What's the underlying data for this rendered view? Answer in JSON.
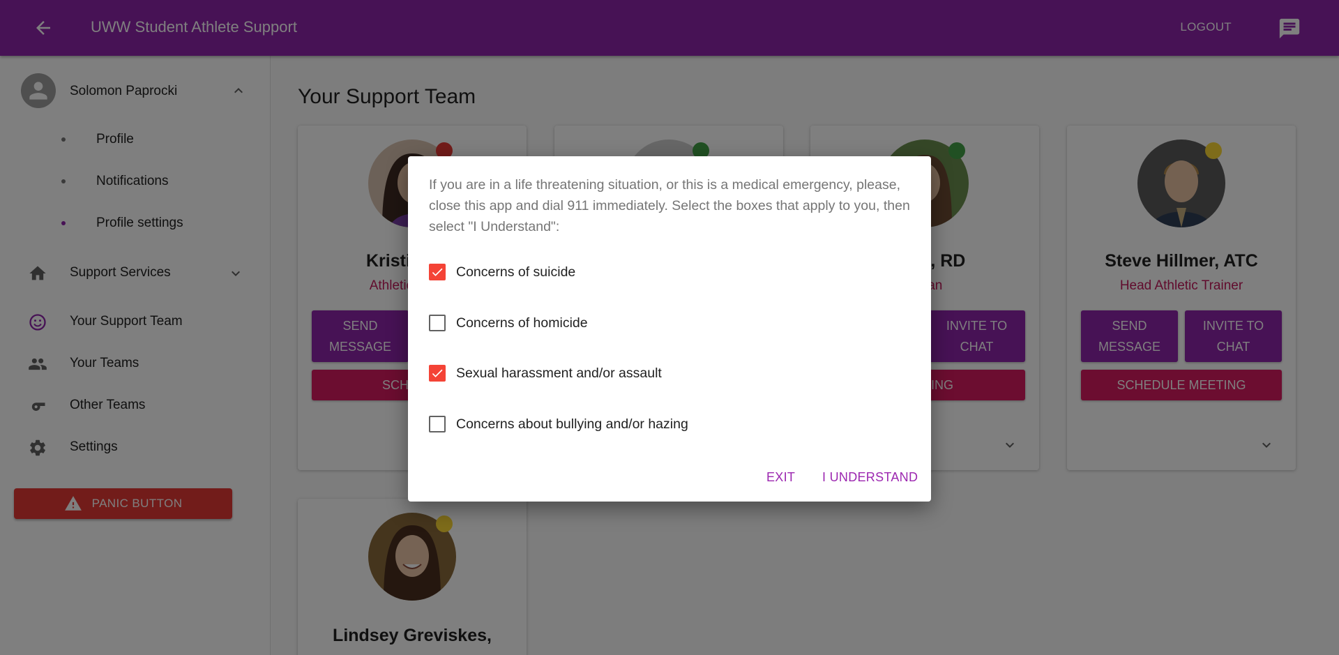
{
  "app": {
    "title": "UWW Student Athlete Support",
    "logout_label": "LOGOUT",
    "colors": {
      "primary": "#8e24aa",
      "secondary": "#d81b60",
      "danger": "#e53935",
      "accent_text": "#c2185b"
    }
  },
  "sidebar": {
    "user_name": "Solomon Paprocki",
    "sub_items": [
      {
        "label": "Profile"
      },
      {
        "label": "Notifications"
      },
      {
        "label": "Profile settings"
      }
    ],
    "items": [
      {
        "label": "Support Services",
        "icon": "home-icon"
      },
      {
        "label": "Your Support Team",
        "icon": "smiley-icon"
      },
      {
        "label": "Your Teams",
        "icon": "people-icon"
      },
      {
        "label": "Other Teams",
        "icon": "whistle-icon"
      },
      {
        "label": "Settings",
        "icon": "gear-icon"
      }
    ],
    "panic_label": "PANIC BUTTON"
  },
  "main": {
    "title": "Your Support Team",
    "cards": [
      {
        "name": "Kristina Na",
        "role": "Athletics Depa",
        "status_color": "#e53935",
        "send_label_1": "SEND",
        "send_label_2": "MESSAGE",
        "schedule_label": "SCHEDUL"
      },
      {
        "status_color": "#43a047"
      },
      {
        "name": "mdoll, RD",
        "role": "etitian",
        "status_color": "#43a047",
        "invite_label_1": "INVITE TO",
        "invite_label_2": "CHAT",
        "schedule_label": "MEETING"
      },
      {
        "name": "Steve Hillmer, ATC",
        "role": "Head Athletic Trainer",
        "status_color": "#fdd835",
        "send_label_1": "SEND",
        "send_label_2": "MESSAGE",
        "invite_label_1": "INVITE TO",
        "invite_label_2": "CHAT",
        "schedule_label": "SCHEDULE MEETING"
      },
      {
        "name": "Lindsey Greviskes,",
        "status_color": "#fdd835"
      }
    ]
  },
  "dialog": {
    "message": "If you are in a life threatening situation, or this is a medical emergency, please, close this app and dial 911 immediately. Select the boxes that apply to you, then select \"I Understand\":",
    "options": [
      {
        "label": "Concerns of suicide",
        "checked": true
      },
      {
        "label": "Concerns of homicide",
        "checked": false
      },
      {
        "label": "Sexual harassment and/or assault",
        "checked": true
      },
      {
        "label": "Concerns about bullying and/or hazing",
        "checked": false
      }
    ],
    "exit_label": "EXIT",
    "understand_label": "I UNDERSTAND"
  }
}
